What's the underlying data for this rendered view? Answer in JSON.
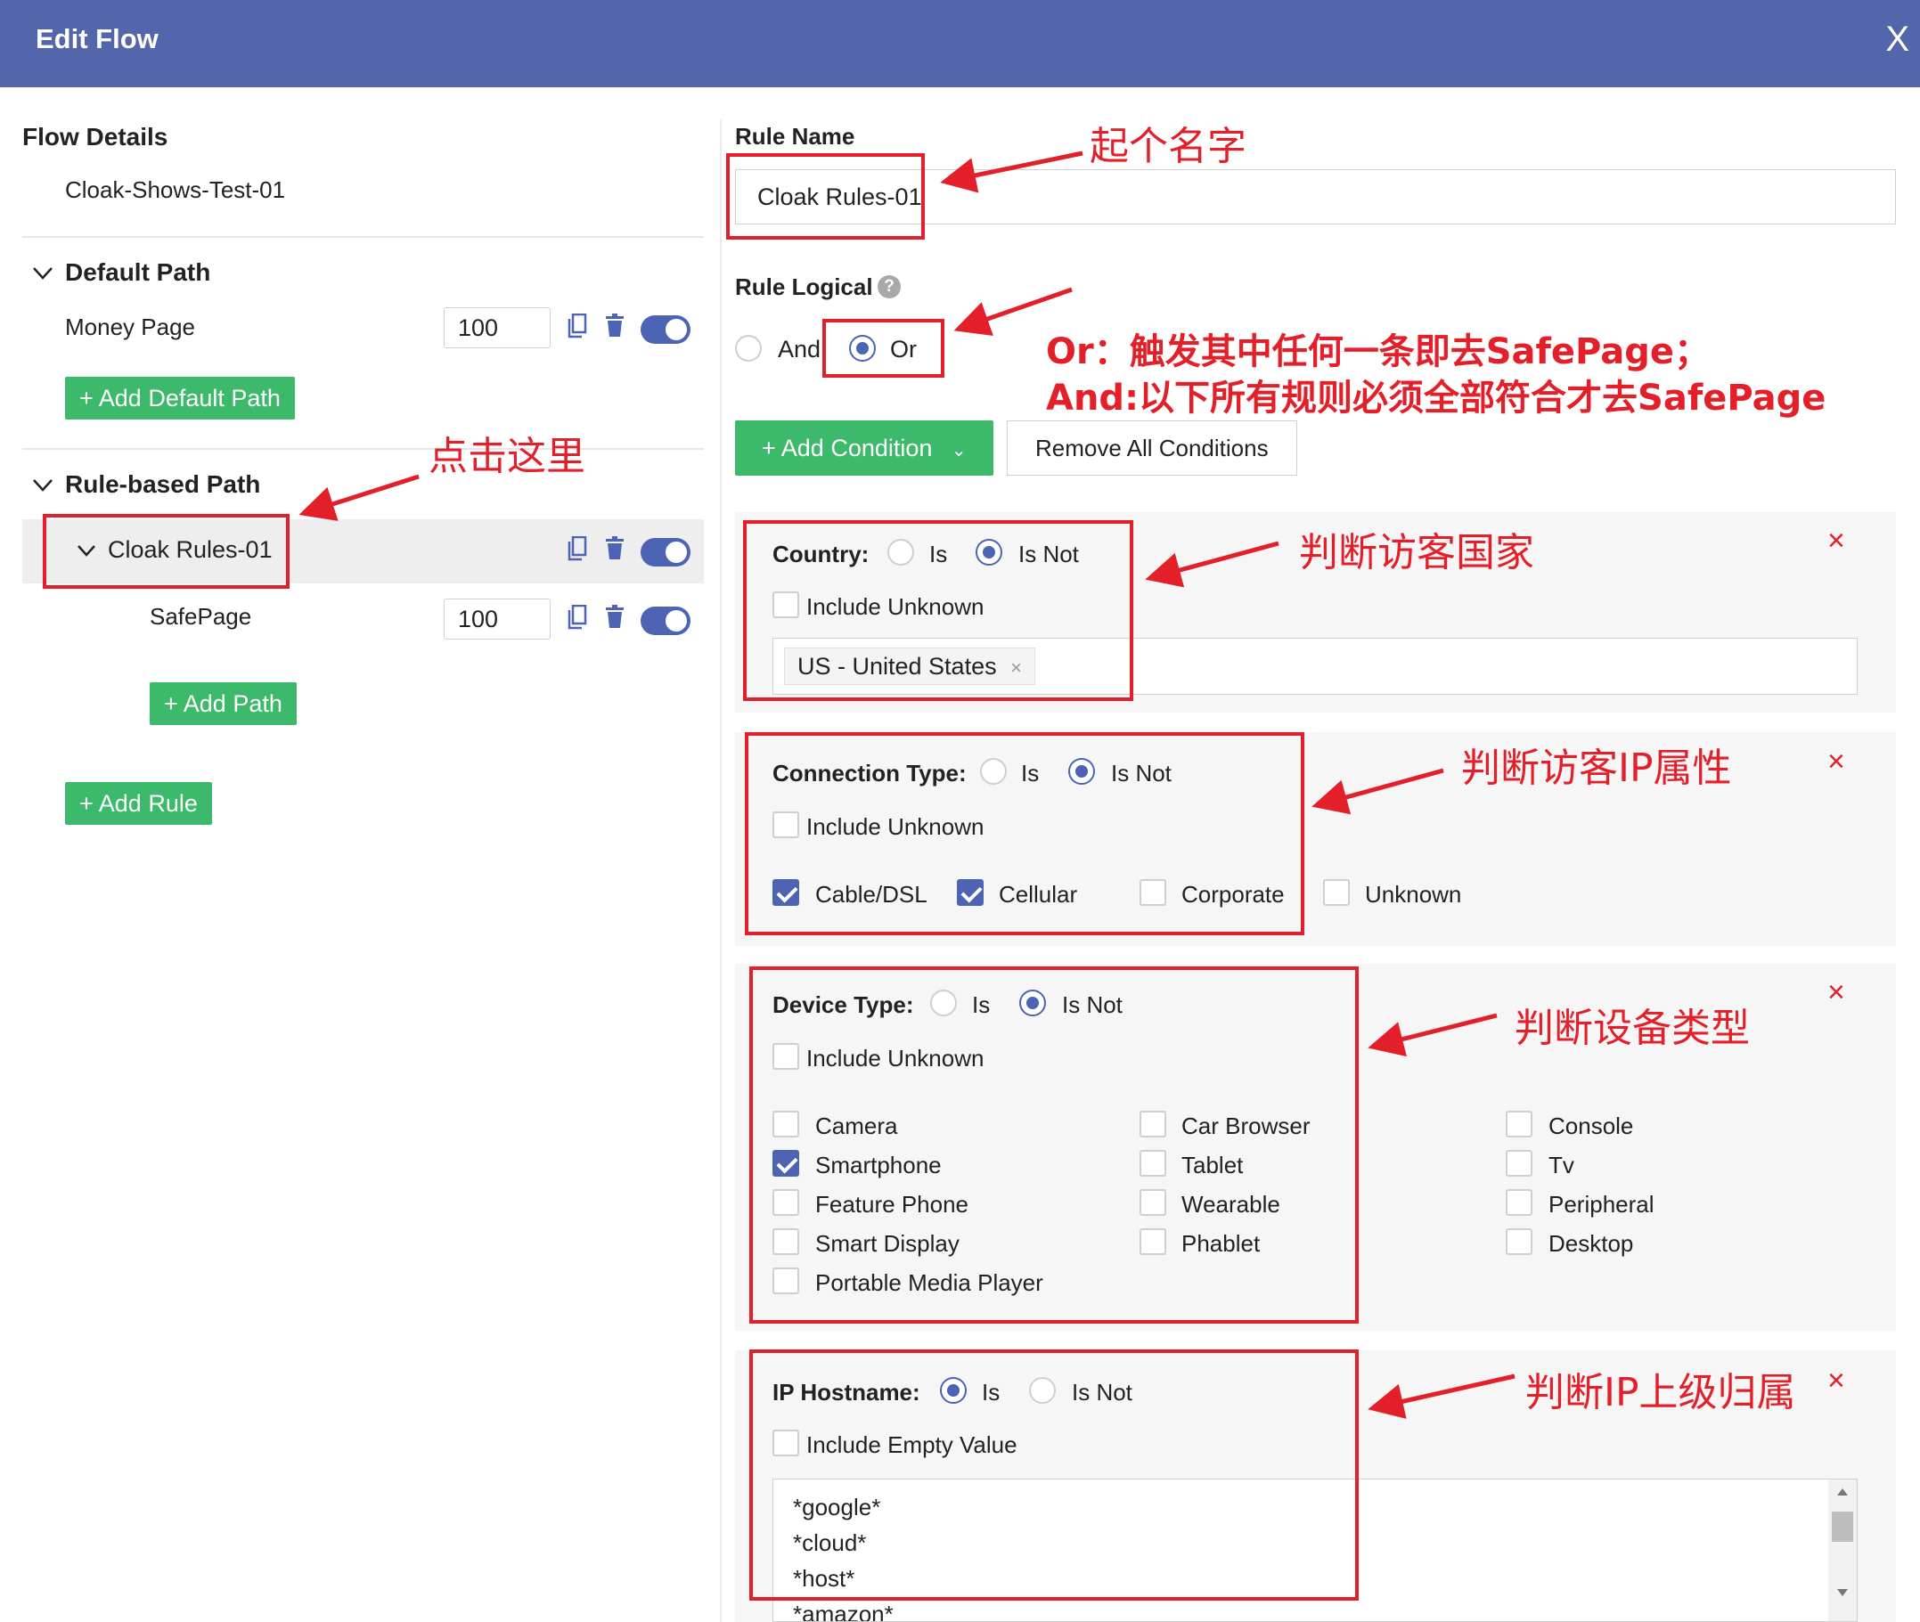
{
  "header": {
    "title": "Edit Flow",
    "close": "X"
  },
  "left": {
    "flow_details_title": "Flow Details",
    "flow_name": "Cloak-Shows-Test-01",
    "default_path_title": "Default Path",
    "money_page_label": "Money Page",
    "money_page_weight": "100",
    "add_default_path": "+ Add Default Path",
    "rule_based_title": "Rule-based Path",
    "rule_name": "Cloak Rules-01",
    "safepage_label": "SafePage",
    "safepage_weight": "100",
    "add_path": "+ Add Path",
    "add_rule": "+ Add Rule"
  },
  "right": {
    "rule_name_label": "Rule Name",
    "rule_name_value": "Cloak Rules-01",
    "rule_logical_label": "Rule Logical",
    "logic_options": [
      "And",
      "Or"
    ],
    "logic_selected": "Or",
    "add_condition": "+ Add Condition",
    "remove_all": "Remove All Conditions",
    "country": {
      "label": "Country:",
      "is": "Is",
      "is_not": "Is Not",
      "selected": "Is Not",
      "include_unknown": "Include Unknown",
      "tag": "US - United States"
    },
    "connection": {
      "label": "Connection Type:",
      "is": "Is",
      "is_not": "Is Not",
      "selected": "Is Not",
      "include_unknown": "Include Unknown",
      "options": [
        {
          "label": "Cable/DSL",
          "checked": true
        },
        {
          "label": "Cellular",
          "checked": true
        },
        {
          "label": "Corporate",
          "checked": false
        },
        {
          "label": "Unknown",
          "checked": false
        }
      ]
    },
    "device": {
      "label": "Device Type:",
      "is": "Is",
      "is_not": "Is Not",
      "selected": "Is Not",
      "include_unknown": "Include Unknown",
      "col1": [
        {
          "label": "Camera",
          "checked": false
        },
        {
          "label": "Smartphone",
          "checked": true
        },
        {
          "label": "Feature Phone",
          "checked": false
        },
        {
          "label": "Smart Display",
          "checked": false
        },
        {
          "label": "Portable Media Player",
          "checked": false
        }
      ],
      "col2": [
        {
          "label": "Car Browser",
          "checked": false
        },
        {
          "label": "Tablet",
          "checked": false
        },
        {
          "label": "Wearable",
          "checked": false
        },
        {
          "label": "Phablet",
          "checked": false
        }
      ],
      "col3": [
        {
          "label": "Console",
          "checked": false
        },
        {
          "label": "Tv",
          "checked": false
        },
        {
          "label": "Peripheral",
          "checked": false
        },
        {
          "label": "Desktop",
          "checked": false
        }
      ]
    },
    "hostname": {
      "label": "IP Hostname:",
      "is": "Is",
      "is_not": "Is Not",
      "selected": "Is",
      "include_empty": "Include Empty Value",
      "lines": [
        "*google*",
        "*cloud*",
        "*host*",
        "*amazon*"
      ]
    }
  },
  "annotations": {
    "name_it": "起个名字",
    "click_here": "点击这里",
    "or_note": "Or：触发其中任何一条即去SafePage；",
    "and_note": "And:以下所有规则必须全部符合才去SafePage",
    "country_note": "判断访客国家",
    "ip_note": "判断访客IP属性",
    "device_note": "判断设备类型",
    "host_note": "判断IP上级归属"
  },
  "colors": {
    "header": "#5366ab",
    "accent": "#4d63b4",
    "green": "#3cb96a",
    "annotation_red": "#e3202a"
  }
}
